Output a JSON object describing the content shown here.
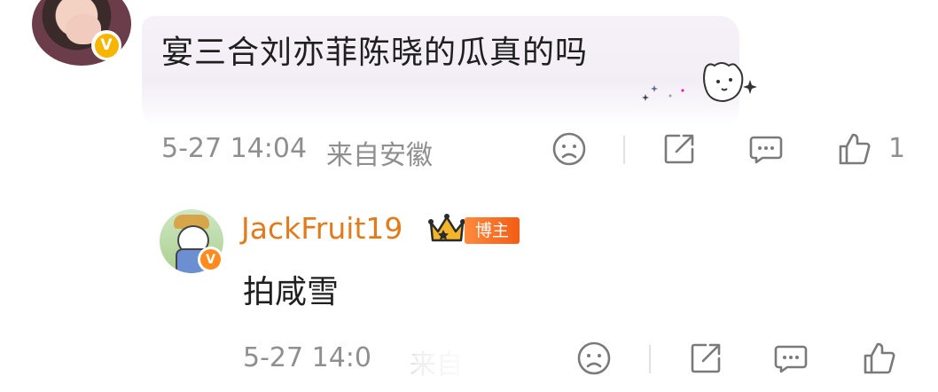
{
  "comment": {
    "text": "宴三合刘亦菲陈晓的瓜真的吗",
    "verified_badge": "V",
    "timestamp": "5-27 14:04",
    "location": "来自安徽",
    "like_count": "1"
  },
  "reply": {
    "username": "JackFruit19",
    "role_badge": "博主",
    "verified_badge": "V",
    "text": "拍咸雪",
    "timestamp": "5-27 14:0",
    "location_partial": "来自"
  },
  "icons": {
    "dislike": "sad-face-icon",
    "share": "share-icon",
    "comment": "comment-icon",
    "like": "thumbs-up-icon",
    "crown": "crown-icon"
  },
  "colors": {
    "username": "#e17b1c",
    "verified_gold": "#f7b500",
    "verified_orange": "#ff8b1f",
    "meta_gray": "#8f8f8f",
    "icon_gray": "#7a7a7a"
  }
}
